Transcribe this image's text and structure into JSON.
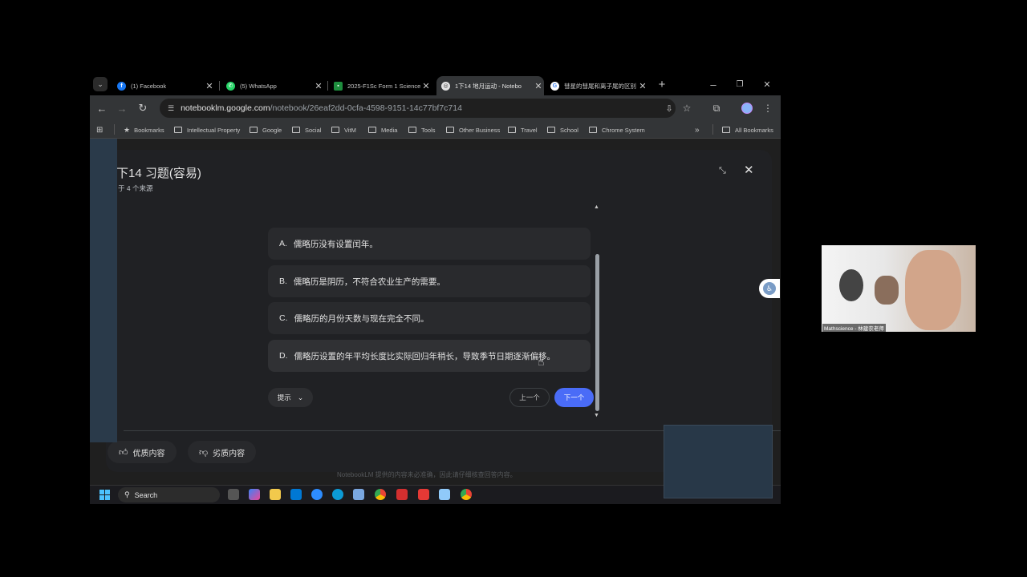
{
  "tabs": [
    {
      "label": "(1) Facebook",
      "icon": "facebook-icon",
      "color": "#1877f2"
    },
    {
      "label": "(5) WhatsApp",
      "icon": "whatsapp-icon",
      "color": "#25d366"
    },
    {
      "label": "2025-F1Sc Form 1 Science",
      "icon": "classroom-icon",
      "color": "#1e8e3e"
    },
    {
      "label": "1下14 地月运动 - Notebo",
      "icon": "notebooklm-icon",
      "color": "#e3e3e3"
    },
    {
      "label": "彗星的彗尾和离子尾的区别",
      "icon": "google-icon",
      "color": "#4285f4"
    }
  ],
  "url": {
    "domain": "notebooklm.google.com",
    "path": "/notebook/26eaf2dd-0cfa-4598-9151-14c77bf7c714"
  },
  "bookmarks": [
    "Bookmarks",
    "Intellectual Property",
    "Google",
    "Social",
    "VitM",
    "Media",
    "Tools",
    "Other Business",
    "Travel",
    "School",
    "Chrome System"
  ],
  "all_bookmarks": "All Bookmarks",
  "quiz": {
    "title": "下14 习题(容易)",
    "subtitle": "于 4 个来源",
    "options": [
      {
        "letter": "A.",
        "text": "儒略历没有设置闰年。"
      },
      {
        "letter": "B.",
        "text": "儒略历是阴历，不符合农业生产的需要。"
      },
      {
        "letter": "C.",
        "text": "儒略历的月份天数与现在完全不同。"
      },
      {
        "letter": "D.",
        "text": "儒略历设置的年平均长度比实际回归年稍长，导致季节日期逐渐偏移。"
      }
    ],
    "hint_label": "提示",
    "prev_label": "上一个",
    "next_label": "下一个",
    "good_label": "优质内容",
    "bad_label": "劣质内容",
    "disclaimer": "NotebookLM 提供的内容未必准确，因此请仔细核查回答内容。"
  },
  "taskbar": {
    "search_placeholder": "Search"
  },
  "webcam_label": "Mathscience - 林建农老师",
  "colors": {
    "accent": "#4285f4",
    "card": "#202124",
    "option": "#292a2d"
  }
}
